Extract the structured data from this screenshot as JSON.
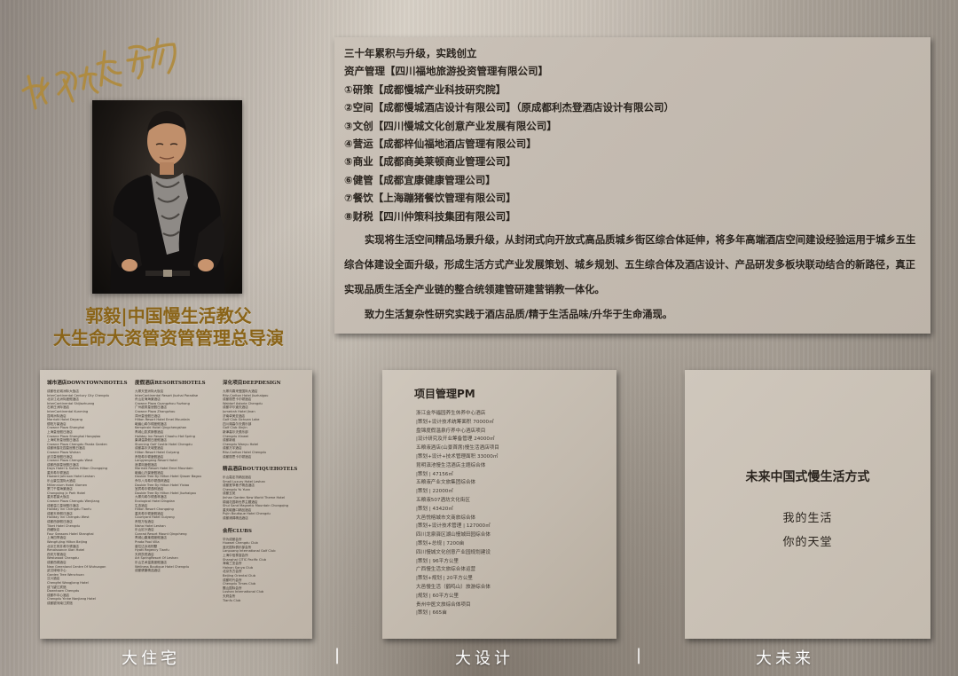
{
  "calligraphy_text": "我们的执行力",
  "profile": {
    "name_line1": "郭毅|中国慢生活教父",
    "name_line2": "大生命大资管资管管理总导演"
  },
  "info": {
    "lines": [
      "三十年累积与升级，实践创立",
      "资产管理【四川福地旅游投资管理有限公司】",
      "①研策【成都慢城产业科技研究院】",
      "②空间【成都慢城酒店设计有限公司】（原成都利杰登酒店设计有限公司）",
      "③文创【四川慢城文化创意产业发展有限公司】",
      "④营运【成都梓仙福地酒店管理有限公司】",
      "⑤商业【成都商美莱顿商业管理公司】",
      "⑥健管【成都宜康健康管理公司】",
      "⑦餐饮【上海蹦猪餐饮管理有限公司】",
      "⑧财税【四川仲策科技集团有限公司】"
    ],
    "paragraph1": "实现将生活空间精品场景升级，从封闭式向开放式高品质城乡街区综合体延伸，将多年高端酒店空间建设经验运用于城乡五生综合体建设全面升级，形成生活方式产业发展策划、城乡规划、五生综合体及酒店设计、产品研发多板块联动结合的新路径，真正实现品质生活全产业链的整合统领建管研建营销教一体化。",
    "paragraph2": "致力生活复杂性研究实践于酒店品质/精于生活品味/升华于生命涌现。"
  },
  "card1": {
    "col1_head": "城市酒店DOWNTOWNHOTELS",
    "col1_items": [
      "成都世纪城洲际大饭店",
      "InterContinental Century City Chengdu",
      "北京江北洲际度假酒店",
      "InterContinental Shijiazhuang",
      "石家庄洲际酒店",
      "InterContinental Kunming",
      "昆明洲际酒店",
      "Marriott Hotel Deyang",
      "德阳万豪酒店",
      "Crowne Plaza Shanghai",
      "上海皇冠假日酒店",
      "Crowne Plaza Shanghai Hongqiao",
      "上海虹桥皇冠假日酒店",
      "Crowne Plaza Chengdu Panda Garden",
      "成都熊猫花园皇冠假日酒店",
      "Crowne Plaza Wuhan",
      "武汉皇冠假日酒店",
      "Crowne Plaza Chengdu West",
      "成都西部皇冠假日酒店",
      "Days Hotel & Suites Hilton Chongqing",
      "重庆希尔顿酒店",
      "Howard Johnson Hotel Leshan",
      "乐山豪生国际大酒店",
      "Millennium Hotel Xiamen",
      "厦门千禧海景酒店",
      "Chongqing Jc Park Hotel",
      "重庆君豪大饭店",
      "Crowne Plaza Chengdu Wenjiang",
      "成都温江皇冠假日酒店",
      "Holiday Inn Chengdu Tianfu",
      "成都天府假日酒店",
      "Holiday Inn Chengdu West",
      "成都西部假日酒店",
      "Tibet Hotel Chengdu",
      "西藏饭店",
      "Four Seasons Hotel Shanghai",
      "上海四季酒店",
      "Wangfujing Hilton Beijing",
      "北京王府井希尔顿酒店",
      "Renaissance Xian Hotel",
      "西安万丽酒店",
      "Westwood Chengdu",
      "成都西锦酒店",
      "New Greenland Centre Of Wuhuagan",
      "武汉绿地中心",
      "Garden Tree Wenchuan",
      "汶川酒店",
      "Chengfei Wangjiang Hotel",
      "成飞望江宾馆",
      "Downtown Chengdu",
      "成都市中心酒店",
      "Chengdu Yinhe Nanjiang Hotel",
      "成都银河南江宾馆"
    ],
    "col2_head": "度假酒店RESORTSHOTELS",
    "col2_items": [
      "九寨天堂洲际大饭店",
      "InterContinental Resort Jiuzhai Paradise",
      "舟山定海海景酒店",
      "Crowne Plaza Guangzhou Yuzhong",
      "广州越秀皇冠假日酒店",
      "Crowne Plaza Zhangzhou",
      "漳州皇冠假日酒店",
      "Hilton Resort Hotel Emei Mountain",
      "峨眉山希尔顿度假酒店",
      "Kempinski Hotel Qingchengshan",
      "青城山凯宾斯基酒店",
      "Holiday Inn Resort Chaohu Hot Spring",
      "巢湖温泉假日度假酒店",
      "Stunning Golf Castle Hotel Chengdu",
      "成都高尔夫城堡酒店",
      "Hilton Resort Hotel Guiyang",
      "贵阳希尔顿度假酒店",
      "Langyangang Resort Hotel",
      "浪漾岗度假酒店",
      "Marriott Resort Hotel Emei Mountain",
      "峨眉山万豪度假酒店",
      "Double Tree By Hilton Hotel Qiaoer Bagou",
      "乔尔八沟希尔顿逸林酒店",
      "Double Tree By Hilton Hotel Yixiao",
      "宜宾希尔顿逸林酒店",
      "Double Tree By Hilton Hotel Jiuzhaigou",
      "九寨沟希尔顿逸林酒店",
      "Ecological Hotel Dingdan",
      "生态酒店",
      "Hilton Resort Chongqing",
      "重庆希尔顿度假酒店",
      "Courtyard Hotel Guiyang",
      "贵阳万怡酒店",
      "Nisha Hotel Leshan",
      "乐山尼沙酒店",
      "Conrad Resort Mount Qingcheng",
      "青城山康莱德度假酒店",
      "Prada Pool Villa",
      "普拉达泳池别墅",
      "Hyatt Regency Tianfu",
      "天府凯悦酒店",
      "Art SpringResort Of Leshan",
      "乐山艺术温泉度假酒店",
      "Wellness Boutique Hotel Chengdu",
      "成都健康精品酒店"
    ],
    "col3_head": "深化项目DEEPDESIGN",
    "col3_items": [
      "九寨沟喜来登国际大酒店",
      "Ritz-Carlton Hotel Jiuzhaigou",
      "成都丽思卡尔顿酒店",
      "Waldorf Astoria Chengdu",
      "成都华尔道夫酒店",
      "Jumeirah Hotel Jinan",
      "济南卓美亚酒店",
      "Golf Club Sichuan Lake",
      "四川湖高尔夫俱乐部",
      "Golf Club Xinjin",
      "新津高尔夫俱乐部",
      "Chengdu Xinwei",
      "成都新维",
      "Chengdu Wanyu Hotel",
      "成都万宇酒店",
      "Ritz-Carlton Hotel Chengdu",
      "成都丽思卡尔顿酒店"
    ],
    "col3_sub1_head": "精品酒店BOUTIQUEHOTELS",
    "col3_sub1_items": [
      "乐山嘉定坊精品酒店",
      "Small Luxury Hotel Leshan",
      "成都宽窄巷子精品酒店",
      "Chengdu Yu Yuan",
      "成都玉苑",
      "Jinhan Garden New World Theme Hotel",
      "锦涵花园新世界主题酒店",
      "Shui Sand Magnetic Mountain Chongqing",
      "重庆磁器口精品酒店",
      "Pujin Boutique Hotel Chengdu",
      "成都浦锦精品酒店"
    ],
    "col3_sub2_head": "会所CLUBS",
    "col3_sub2_items": [
      "华为成都会所",
      "Huawei Chengdu Club",
      "蓝光国际俱乐部会所",
      "Lanpuang International Golf Club",
      "上海中信泰富会所",
      "Shanghai CITIC Pacific Club",
      "海南三亚会所",
      "Hainan Sanya Club",
      "北京东方会所",
      "Beijing Oriental Club",
      "成都时代会所",
      "Chengdu Times Club",
      "麓山国际会所",
      "Lushan International Club",
      "天府会所",
      "Tianfu Club"
    ]
  },
  "card2": {
    "title": "项目管理PM",
    "items": [
      "浙江金华福园养生休养中心酒店",
      "|策划+设计技术统筹面积 70000㎡",
      "盘锦度假温泉疗养中心酒店项目",
      "|设计研究及开业筹备管理 24000㎡",
      "五粮液酒店(山景首席)慢生活酒店项目",
      "|策划+设计+技术管理面积 33000㎡",
      "昆明滇池慢生活酒店主题综合体",
      "|策划 | 47156㎡",
      "五粮液产业文旅集团综合体",
      "|策划 | 22000㎡",
      "五粮液507酒坊文化街区",
      "|策划 | 43420㎡",
      "大邑悦榕城市文商旅综合体",
      "|策划+设计技术管理 | 127000㎡",
      "四川龙泉驿区湖山慢城田园综合体",
      "|策划+总规 | 7200亩",
      "四川慢城文化创意产业园规划建设",
      "|策划 | 96平方公里",
      "广西慢生活文旅综合体运营",
      "|策划+规划 | 20平方公里",
      "大邑慢生活（鹤鸣山）旅游综合体",
      "|规划 | 60平方公里",
      "贵州中医文旅综合体项目",
      "|策划 | 665亩"
    ]
  },
  "card3": {
    "title": "未来中国式慢生活方式",
    "line1": "我的生活",
    "line2": "你的天堂"
  },
  "captions": {
    "c1": "大住宅",
    "c2": "大设计",
    "c3": "大未来",
    "sep": "|"
  },
  "colors": {
    "gold": "#8a6418",
    "card": "#c6bdb2",
    "text": "#2a241e"
  }
}
